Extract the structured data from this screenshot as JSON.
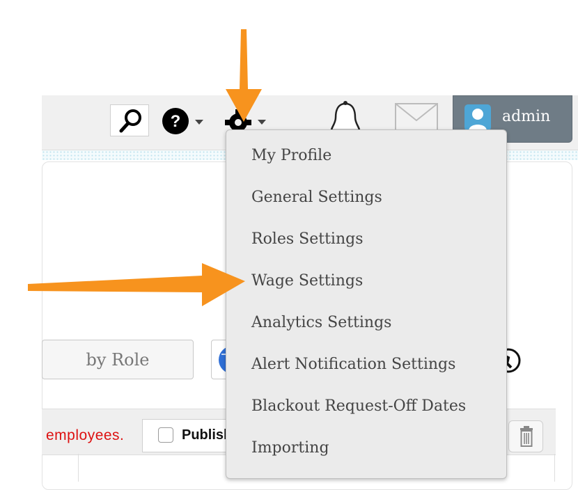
{
  "header": {
    "user_label": "admin",
    "icons": [
      "search-icon",
      "help-icon",
      "gear-icon",
      "bell-icon",
      "mail-icon",
      "user-avatar-icon"
    ]
  },
  "settings_menu": {
    "items": [
      {
        "label": "My Profile"
      },
      {
        "label": "General Settings"
      },
      {
        "label": "Roles Settings"
      },
      {
        "label": "Wage Settings"
      },
      {
        "label": "Analytics Settings"
      },
      {
        "label": "Alert Notification Settings"
      },
      {
        "label": "Blackout Request-Off Dates"
      },
      {
        "label": "Importing"
      }
    ]
  },
  "filters": {
    "role_button": "by Role"
  },
  "schedule_row": {
    "employees_text": "employees.",
    "publish_label": "Publish"
  },
  "colors": {
    "accent_arrow": "#f7931e",
    "admin_bg": "#6f7c86",
    "warning_text": "#dd1111"
  }
}
